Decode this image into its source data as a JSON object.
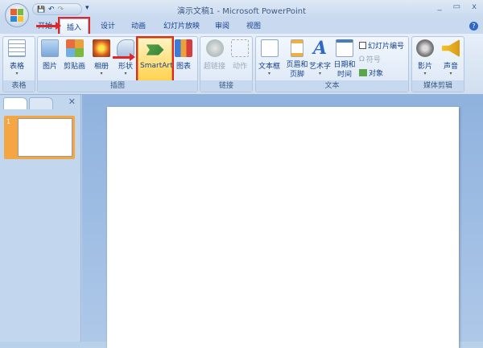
{
  "window": {
    "title": "演示文稿1 - Microsoft PowerPoint",
    "minimize": "_",
    "maximize": "▭",
    "close": "x"
  },
  "qat": {
    "save": "💾",
    "undo": "↶",
    "redo": "↷",
    "more": "▾"
  },
  "tabs": [
    "开始",
    "插入",
    "设计",
    "动画",
    "幻灯片放映",
    "审阅",
    "视图"
  ],
  "help": "?",
  "ribbon": {
    "groups": [
      {
        "label": "表格",
        "buttons": [
          "表格"
        ]
      },
      {
        "label": "插图",
        "buttons": [
          "图片",
          "剪贴画",
          "相册",
          "形状",
          "SmartArt",
          "图表"
        ]
      },
      {
        "label": "链接",
        "buttons": [
          "超链接",
          "动作"
        ]
      },
      {
        "label": "文本",
        "buttons": [
          "文本框",
          "页眉和页脚",
          "艺术字",
          "日期和时间"
        ],
        "small": [
          "幻灯片编号",
          "符号",
          "对象"
        ]
      },
      {
        "label": "媒体剪辑",
        "buttons": [
          "影片",
          "声音"
        ]
      }
    ]
  },
  "pane": {
    "close": "✕",
    "slide_number": "1"
  },
  "colors": {
    "highlight": "#e02626",
    "accent": "#f4a644"
  }
}
